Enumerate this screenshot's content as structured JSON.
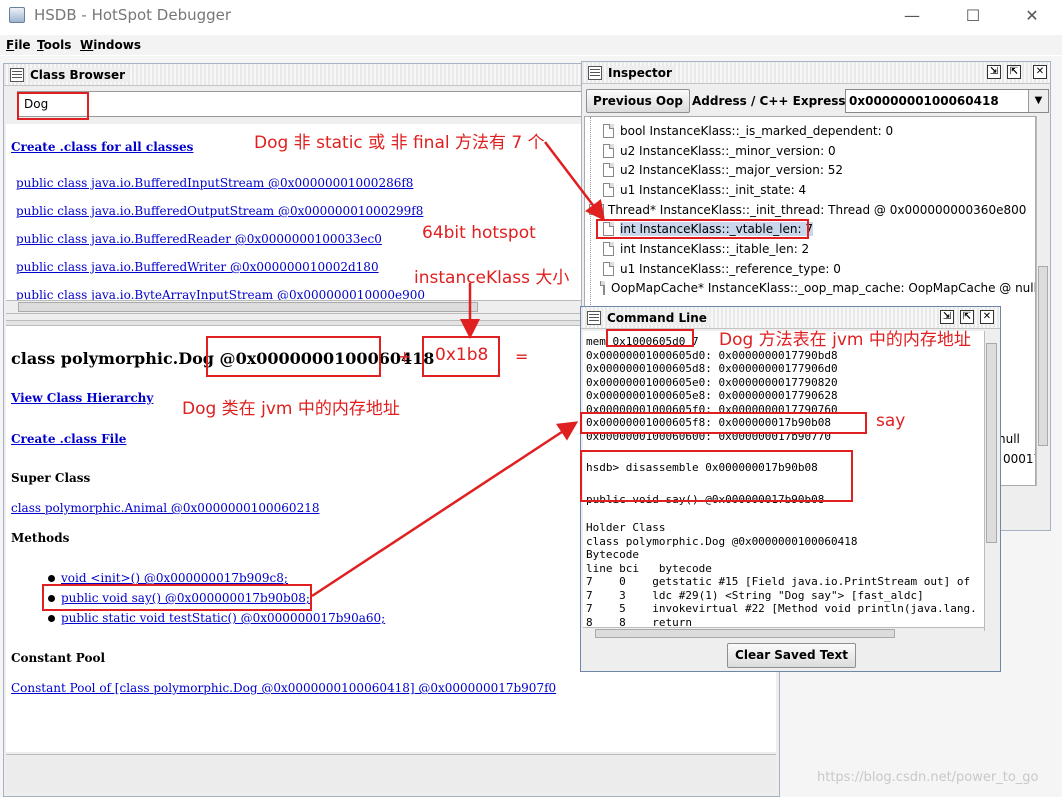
{
  "window": {
    "title": "HSDB - HotSpot Debugger",
    "minimize": "—",
    "maximize": "☐",
    "close": "✕"
  },
  "menu": [
    {
      "label": "File",
      "u": "F",
      "rest": "ile"
    },
    {
      "label": "Tools",
      "u": "T",
      "rest": "ools"
    },
    {
      "label": "Windows",
      "u": "W",
      "rest": "indows"
    }
  ],
  "class_browser": {
    "title": "Class Browser",
    "search_value": "Dog",
    "create_all": "Create .class for all classes",
    "classes": [
      "public class java.io.BufferedInputStream @0x00000001000286f8",
      "public class java.io.BufferedOutputStream @0x00000001000299f8",
      "public class java.io.BufferedReader @0x0000000100033ec0",
      "public class java.io.BufferedWriter @0x000000010002d180",
      "public class java.io.ByteArrayInputStream @0x000000010000e900"
    ],
    "detail": {
      "heading_prefix": "class polymorphic.Dog @",
      "heading_addr": "0x0000000100060418",
      "view_hierarchy": "View Class Hierarchy",
      "create_class": "Create .class File",
      "super_class_label": "Super Class",
      "super_class": "class polymorphic.Animal @0x0000000100060218",
      "methods_label": "Methods",
      "methods": [
        "void <init>() @0x000000017b909c8;",
        "public void say() @0x000000017b90b08;",
        "public static void testStatic() @0x000000017b90a60;"
      ],
      "constant_pool_label": "Constant Pool",
      "constant_pool": "Constant Pool of [class polymorphic.Dog @0x0000000100060418] @0x000000017b907f0"
    }
  },
  "inspector": {
    "title": "Inspector",
    "prev_oop": "Previous Oop",
    "addr_label": "Address / C++ Expression:",
    "addr_value": "0x0000000100060418",
    "rows": [
      {
        "icon": "doc",
        "text": "bool InstanceKlass::_is_marked_dependent: 0"
      },
      {
        "icon": "doc",
        "text": "u2 InstanceKlass::_minor_version: 0"
      },
      {
        "icon": "doc",
        "text": "u2 InstanceKlass::_major_version: 52"
      },
      {
        "icon": "doc",
        "text": "u1 InstanceKlass::_init_state: 4"
      },
      {
        "icon": "folder",
        "text": "Thread* InstanceKlass::_init_thread: Thread @ 0x000000000360e800"
      },
      {
        "icon": "doc",
        "text": "int InstanceKlass::_vtable_len: 7"
      },
      {
        "icon": "doc",
        "text": "int InstanceKlass::_itable_len: 2"
      },
      {
        "icon": "doc",
        "text": "u1 InstanceKlass::_reference_type: 0"
      },
      {
        "icon": "doc",
        "text": "OopMapCache* InstanceKlass::_oop_map_cache: OopMapCache @ null"
      }
    ],
    "peek_1": "null",
    "peek_2": "00017"
  },
  "command_line": {
    "title": "Command Line",
    "mem_prefix": "mem ",
    "mem_addr": "0x1000605d0",
    "mem_suffix": " 7",
    "mem_lines": [
      "0x00000001000605d0: 0x0000000017790bd8",
      "0x00000001000605d8: 0x00000000177906d0",
      "0x00000001000605e0: 0x0000000017790820",
      "0x00000001000605e8: 0x0000000017790628",
      "0x00000001000605f0: 0x0000000017790760",
      "0x00000001000605f8: 0x000000017b90b08",
      "0x0000000100060600: 0x000000017b90770"
    ],
    "prompt": "hsdb> disassemble 0x000000017b90b08",
    "method_sig": "public void say() @0x000000017b90b08",
    "holder_label": "Holder Class",
    "holder": "class polymorphic.Dog @0x0000000100060418",
    "bytecode_label": "Bytecode",
    "bc_header": "line bci   bytecode",
    "bc_rows": [
      "7    0    getstatic #15 [Field java.io.PrintStream out] of",
      "7    3    ldc #29(1) <String \"Dog say\"> [fast_aldc]",
      "7    5    invokevirtual #22 [Method void println(java.lang.",
      "8    8    return"
    ],
    "clear_button": "Clear Saved Text"
  },
  "annotations": {
    "vtable_note": "Dog 非 static 或 非 final 方法有 7 个",
    "hotspot_note": "64bit hotspot",
    "size_note": "instanceKlass 大小",
    "size_value": "0x1b8",
    "plus": "+",
    "equals": "=",
    "class_addr_note": "Dog 类在 jvm 中的内存地址",
    "vtable_addr_note": "Dog 方法表在 jvm 中的内存地址",
    "say_note": "say"
  },
  "watermark": "https://blog.csdn.net/power_to_go",
  "colors": {
    "annotation": "#e02020",
    "link": "#0000cc"
  }
}
